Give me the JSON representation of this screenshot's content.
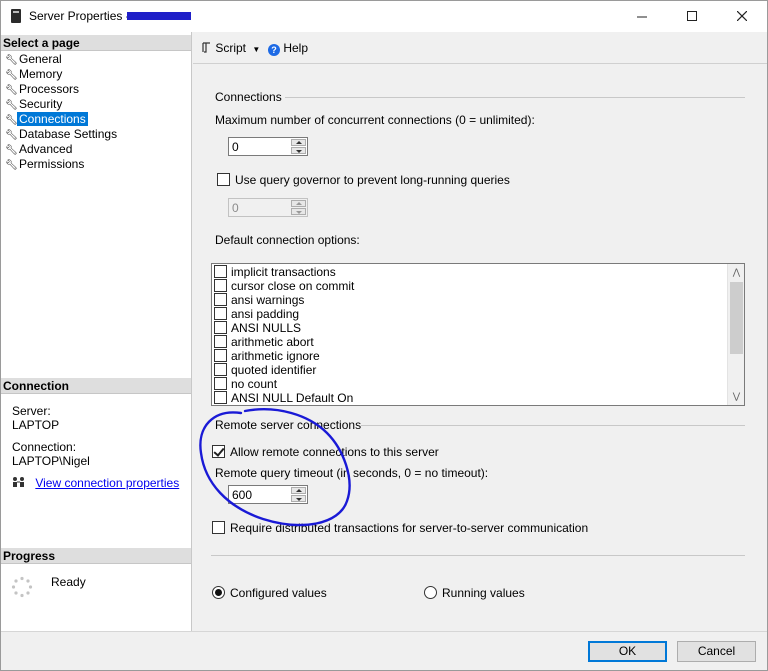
{
  "window": {
    "title": "Server Properties - "
  },
  "left": {
    "select_page_header": "Select a page",
    "pages": [
      {
        "label": "General",
        "selected": false
      },
      {
        "label": "Memory",
        "selected": false
      },
      {
        "label": "Processors",
        "selected": false
      },
      {
        "label": "Security",
        "selected": false
      },
      {
        "label": "Connections",
        "selected": true
      },
      {
        "label": "Database Settings",
        "selected": false
      },
      {
        "label": "Advanced",
        "selected": false
      },
      {
        "label": "Permissions",
        "selected": false
      }
    ],
    "connection_header": "Connection",
    "server_label": "Server:",
    "server_value": "LAPTOP",
    "connection_label": "Connection:",
    "connection_value": "LAPTOP\\Nigel",
    "view_link": "View connection properties",
    "progress_header": "Progress",
    "progress_status": "Ready"
  },
  "toolbar": {
    "script_label": "Script",
    "help_label": "Help"
  },
  "connections": {
    "group_label": "Connections",
    "max_label": "Maximum number of concurrent connections (0 = unlimited):",
    "max_value": "0",
    "governor_label": "Use query governor to prevent long-running queries",
    "governor_checked": false,
    "governor_value": "0",
    "default_options_label": "Default connection options:",
    "options": [
      {
        "label": "implicit transactions",
        "checked": false
      },
      {
        "label": "cursor close on commit",
        "checked": false
      },
      {
        "label": "ansi warnings",
        "checked": false
      },
      {
        "label": "ansi padding",
        "checked": false
      },
      {
        "label": "ANSI NULLS",
        "checked": false
      },
      {
        "label": "arithmetic abort",
        "checked": false
      },
      {
        "label": "arithmetic ignore",
        "checked": false
      },
      {
        "label": "quoted identifier",
        "checked": false
      },
      {
        "label": "no count",
        "checked": false
      },
      {
        "label": "ANSI NULL Default On",
        "checked": false
      }
    ]
  },
  "remote": {
    "group_label": "Remote server connections",
    "allow_label": "Allow remote connections to this server",
    "allow_checked": true,
    "timeout_label": "Remote query timeout (in seconds, 0 = no timeout):",
    "timeout_value": "600",
    "distributed_label": "Require distributed transactions for server-to-server communication",
    "distributed_checked": false
  },
  "values_mode": {
    "configured_label": "Configured values",
    "running_label": "Running values",
    "selected": "configured"
  },
  "footer": {
    "ok_label": "OK",
    "cancel_label": "Cancel"
  },
  "colors": {
    "selection": "#0078d7",
    "link": "#0000ee",
    "annotation": "#1a1ad6"
  }
}
